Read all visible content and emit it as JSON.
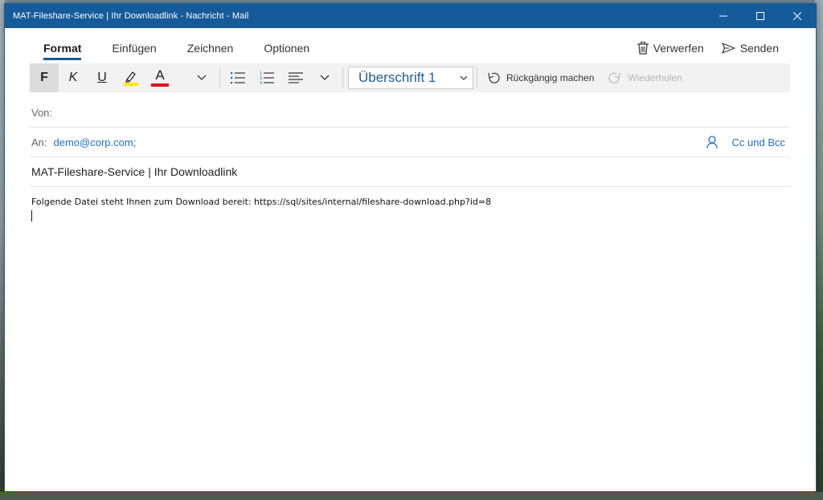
{
  "window": {
    "title": "MAT-Fileshare-Service | Ihr Downloadlink - Nachricht - Mail",
    "controls": {
      "minimize": "—",
      "maximize": "☐",
      "close": "✕"
    }
  },
  "tabs": [
    {
      "label": "Format",
      "active": true
    },
    {
      "label": "Einfügen",
      "active": false
    },
    {
      "label": "Zeichnen",
      "active": false
    },
    {
      "label": "Optionen",
      "active": false
    }
  ],
  "actions": {
    "discard_label": "Verwerfen",
    "send_label": "Senden"
  },
  "toolbar": {
    "bold": "F",
    "italic": "K",
    "underline": "U",
    "font_color_letter": "A",
    "style_value": "Überschrift 1",
    "undo_label": "Rückgängig machen",
    "redo_label": "Wiederholen",
    "highlight_color": "#ffe600",
    "font_color": "#e3121b"
  },
  "fields": {
    "from_label": "Von:",
    "to_label": "An:",
    "to_value": "demo@corp.com;",
    "cc_label": "Cc und Bcc",
    "subject": "MAT-Fileshare-Service | Ihr Downloadlink"
  },
  "body": {
    "text": "Folgende Datei steht Ihnen zum Download bereit: https://sql/sites/internal/fileshare-download.php?id=8"
  },
  "colors": {
    "accent": "#155b9a",
    "link": "#1f6fbf"
  }
}
